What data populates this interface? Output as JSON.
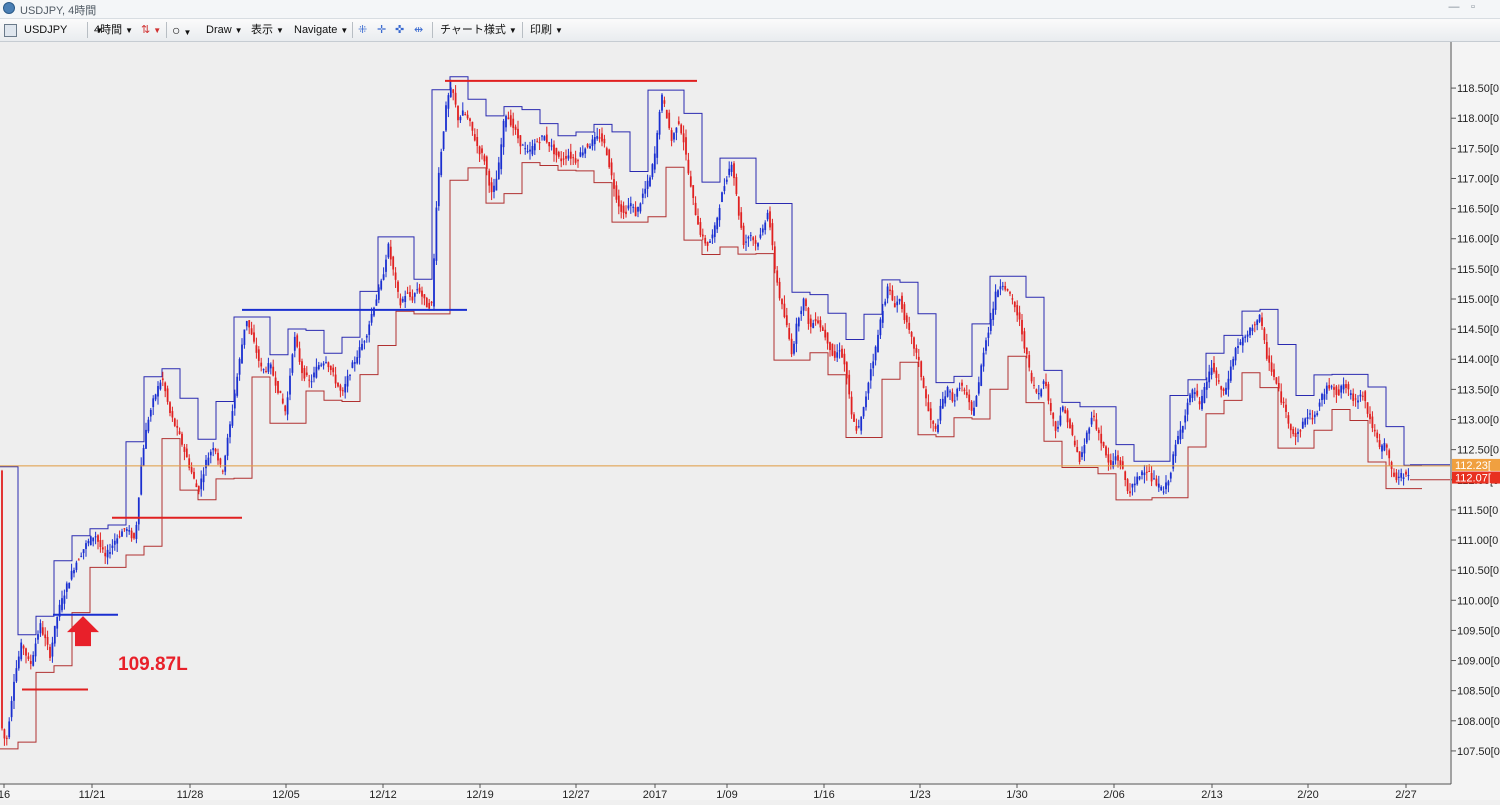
{
  "window": {
    "title": "USDJPY, 4時間",
    "minimize": "—",
    "restore": "▫"
  },
  "toolbar": {
    "symbol": "USDJPY",
    "timeframe": "4時間",
    "draw": "Draw",
    "display": "表示",
    "navigate": "Navigate",
    "chart_style": "チャート様式",
    "print": "印刷"
  },
  "annotation": {
    "label": "109.87L",
    "color": "#e8202a"
  },
  "colors": {
    "bull": "#1a2fd0",
    "bear": "#e02020",
    "channel_high": "#2a2ab0",
    "channel_low": "#b03030",
    "price_line": "#e09a40",
    "ask_tag": "#f0a040",
    "bid_tag": "#e83020"
  },
  "chart_data": {
    "type": "candlestick",
    "symbol": "USDJPY",
    "timeframe": "4時間",
    "ylim": [
      107.2,
      118.85
    ],
    "x_labels": [
      "16",
      "11/21",
      "11/28",
      "12/05",
      "12/12",
      "12/19",
      "12/27",
      "2017",
      "1/09",
      "1/16",
      "1/23",
      "1/30",
      "2/06",
      "2/13",
      "2/20",
      "2/27"
    ],
    "y_ticks": [
      "118.50[0",
      "118.00[0",
      "117.50[0",
      "117.00[0",
      "116.50[0",
      "116.00[0",
      "115.50[0",
      "115.00[0",
      "114.50[0",
      "114.00[0",
      "113.50[0",
      "113.00[0",
      "112.50[0",
      "112.00[0",
      "111.50[0",
      "111.00[0",
      "110.50[0",
      "110.00[0",
      "109.50[0",
      "109.00[0",
      "108.50[0",
      "108.00[0",
      "107.50[0"
    ],
    "price_tags": {
      "ask": "112.23[",
      "bid": "112.07["
    },
    "current_price": 112.23,
    "path": [
      [
        0,
        108.0
      ],
      [
        6,
        107.6
      ],
      [
        14,
        108.7
      ],
      [
        22,
        109.3
      ],
      [
        30,
        108.9
      ],
      [
        40,
        109.6
      ],
      [
        50,
        109.1
      ],
      [
        58,
        109.8
      ],
      [
        66,
        110.2
      ],
      [
        75,
        110.6
      ],
      [
        85,
        110.9
      ],
      [
        95,
        111.1
      ],
      [
        105,
        110.7
      ],
      [
        115,
        111.0
      ],
      [
        125,
        111.2
      ],
      [
        135,
        111.0
      ],
      [
        142,
        112.4
      ],
      [
        148,
        113.0
      ],
      [
        155,
        113.4
      ],
      [
        162,
        113.7
      ],
      [
        170,
        113.1
      ],
      [
        180,
        112.7
      ],
      [
        190,
        112.2
      ],
      [
        198,
        111.8
      ],
      [
        206,
        112.3
      ],
      [
        214,
        112.6
      ],
      [
        222,
        112.1
      ],
      [
        230,
        112.9
      ],
      [
        238,
        113.8
      ],
      [
        246,
        114.7
      ],
      [
        255,
        114.2
      ],
      [
        262,
        113.8
      ],
      [
        270,
        113.9
      ],
      [
        278,
        113.5
      ],
      [
        286,
        113.1
      ],
      [
        294,
        114.4
      ],
      [
        302,
        113.8
      ],
      [
        310,
        113.6
      ],
      [
        318,
        113.9
      ],
      [
        326,
        114.0
      ],
      [
        334,
        113.7
      ],
      [
        342,
        113.4
      ],
      [
        350,
        113.8
      ],
      [
        358,
        114.1
      ],
      [
        366,
        114.4
      ],
      [
        374,
        114.9
      ],
      [
        382,
        115.3
      ],
      [
        388,
        115.9
      ],
      [
        394,
        115.4
      ],
      [
        400,
        114.9
      ],
      [
        406,
        115.1
      ],
      [
        412,
        115.0
      ],
      [
        418,
        115.2
      ],
      [
        426,
        114.9
      ],
      [
        432,
        114.9
      ],
      [
        437,
        116.8
      ],
      [
        442,
        117.6
      ],
      [
        447,
        118.3
      ],
      [
        452,
        118.5
      ],
      [
        458,
        118.0
      ],
      [
        464,
        118.1
      ],
      [
        470,
        117.9
      ],
      [
        478,
        117.5
      ],
      [
        485,
        117.3
      ],
      [
        492,
        116.7
      ],
      [
        498,
        117.1
      ],
      [
        505,
        118.1
      ],
      [
        512,
        117.9
      ],
      [
        520,
        117.6
      ],
      [
        528,
        117.4
      ],
      [
        536,
        117.6
      ],
      [
        544,
        117.7
      ],
      [
        552,
        117.5
      ],
      [
        560,
        117.3
      ],
      [
        568,
        117.4
      ],
      [
        576,
        117.3
      ],
      [
        584,
        117.5
      ],
      [
        592,
        117.6
      ],
      [
        600,
        117.7
      ],
      [
        606,
        117.5
      ],
      [
        612,
        117.0
      ],
      [
        618,
        116.6
      ],
      [
        624,
        116.4
      ],
      [
        630,
        116.6
      ],
      [
        636,
        116.4
      ],
      [
        642,
        116.7
      ],
      [
        650,
        117.0
      ],
      [
        656,
        117.5
      ],
      [
        661,
        118.4
      ],
      [
        666,
        118.1
      ],
      [
        672,
        117.6
      ],
      [
        678,
        118.0
      ],
      [
        684,
        117.6
      ],
      [
        690,
        116.9
      ],
      [
        696,
        116.4
      ],
      [
        702,
        116.0
      ],
      [
        708,
        115.9
      ],
      [
        714,
        116.1
      ],
      [
        720,
        116.6
      ],
      [
        726,
        117.0
      ],
      [
        732,
        117.3
      ],
      [
        738,
        116.5
      ],
      [
        744,
        115.9
      ],
      [
        750,
        116.1
      ],
      [
        756,
        115.9
      ],
      [
        762,
        116.1
      ],
      [
        768,
        116.5
      ],
      [
        774,
        115.6
      ],
      [
        780,
        115.0
      ],
      [
        786,
        114.6
      ],
      [
        792,
        114.1
      ],
      [
        798,
        114.7
      ],
      [
        804,
        115.0
      ],
      [
        810,
        114.5
      ],
      [
        816,
        114.7
      ],
      [
        822,
        114.5
      ],
      [
        828,
        114.3
      ],
      [
        834,
        114.0
      ],
      [
        840,
        114.2
      ],
      [
        846,
        113.8
      ],
      [
        852,
        113.0
      ],
      [
        858,
        112.8
      ],
      [
        864,
        113.2
      ],
      [
        870,
        113.8
      ],
      [
        876,
        114.2
      ],
      [
        882,
        114.8
      ],
      [
        888,
        115.2
      ],
      [
        894,
        114.9
      ],
      [
        900,
        115.0
      ],
      [
        906,
        114.6
      ],
      [
        912,
        114.3
      ],
      [
        918,
        114.0
      ],
      [
        924,
        113.5
      ],
      [
        930,
        113.0
      ],
      [
        936,
        112.8
      ],
      [
        942,
        113.3
      ],
      [
        948,
        113.5
      ],
      [
        954,
        113.3
      ],
      [
        960,
        113.6
      ],
      [
        966,
        113.4
      ],
      [
        972,
        113.1
      ],
      [
        978,
        113.5
      ],
      [
        984,
        114.2
      ],
      [
        990,
        114.6
      ],
      [
        996,
        115.1
      ],
      [
        1002,
        115.3
      ],
      [
        1008,
        115.1
      ],
      [
        1014,
        114.9
      ],
      [
        1020,
        114.6
      ],
      [
        1026,
        114.1
      ],
      [
        1032,
        113.6
      ],
      [
        1038,
        113.4
      ],
      [
        1044,
        113.7
      ],
      [
        1050,
        113.2
      ],
      [
        1056,
        112.8
      ],
      [
        1062,
        113.2
      ],
      [
        1068,
        113.0
      ],
      [
        1074,
        112.6
      ],
      [
        1080,
        112.3
      ],
      [
        1086,
        112.7
      ],
      [
        1092,
        113.1
      ],
      [
        1098,
        112.8
      ],
      [
        1104,
        112.5
      ],
      [
        1110,
        112.2
      ],
      [
        1116,
        112.4
      ],
      [
        1122,
        112.2
      ],
      [
        1128,
        111.8
      ],
      [
        1134,
        111.9
      ],
      [
        1140,
        112.1
      ],
      [
        1146,
        112.2
      ],
      [
        1152,
        112.0
      ],
      [
        1158,
        111.9
      ],
      [
        1164,
        111.8
      ],
      [
        1170,
        112.1
      ],
      [
        1176,
        112.6
      ],
      [
        1182,
        112.9
      ],
      [
        1188,
        113.3
      ],
      [
        1194,
        113.5
      ],
      [
        1200,
        113.2
      ],
      [
        1206,
        113.6
      ],
      [
        1212,
        113.9
      ],
      [
        1218,
        113.6
      ],
      [
        1224,
        113.4
      ],
      [
        1230,
        113.8
      ],
      [
        1236,
        114.2
      ],
      [
        1242,
        114.3
      ],
      [
        1248,
        114.4
      ],
      [
        1254,
        114.6
      ],
      [
        1260,
        114.7
      ],
      [
        1266,
        114.1
      ],
      [
        1272,
        113.8
      ],
      [
        1278,
        113.5
      ],
      [
        1284,
        113.2
      ],
      [
        1290,
        112.9
      ],
      [
        1296,
        112.7
      ],
      [
        1302,
        112.9
      ],
      [
        1308,
        113.1
      ],
      [
        1314,
        113.0
      ],
      [
        1320,
        113.3
      ],
      [
        1326,
        113.5
      ],
      [
        1332,
        113.6
      ],
      [
        1338,
        113.4
      ],
      [
        1344,
        113.6
      ],
      [
        1350,
        113.4
      ],
      [
        1356,
        113.3
      ],
      [
        1362,
        113.5
      ],
      [
        1368,
        113.1
      ],
      [
        1374,
        112.8
      ],
      [
        1380,
        112.5
      ],
      [
        1386,
        112.6
      ],
      [
        1392,
        112.1
      ],
      [
        1398,
        112.0
      ],
      [
        1404,
        112.1
      ],
      [
        1410,
        112.15
      ]
    ],
    "horizontal_lines": [
      {
        "price": 108.52,
        "x1": 22,
        "x2": 88,
        "color": "#e02020"
      },
      {
        "price": 109.76,
        "x1": 53,
        "x2": 118,
        "color": "#1a2fd0"
      },
      {
        "price": 111.37,
        "x1": 112,
        "x2": 242,
        "color": "#e02020"
      },
      {
        "price": 114.82,
        "x1": 242,
        "x2": 467,
        "color": "#1a2fd0"
      },
      {
        "price": 118.62,
        "x1": 445,
        "x2": 697,
        "color": "#e02020"
      }
    ],
    "arrow": {
      "direction": "up",
      "at_price": 109.87,
      "x": 83
    }
  }
}
